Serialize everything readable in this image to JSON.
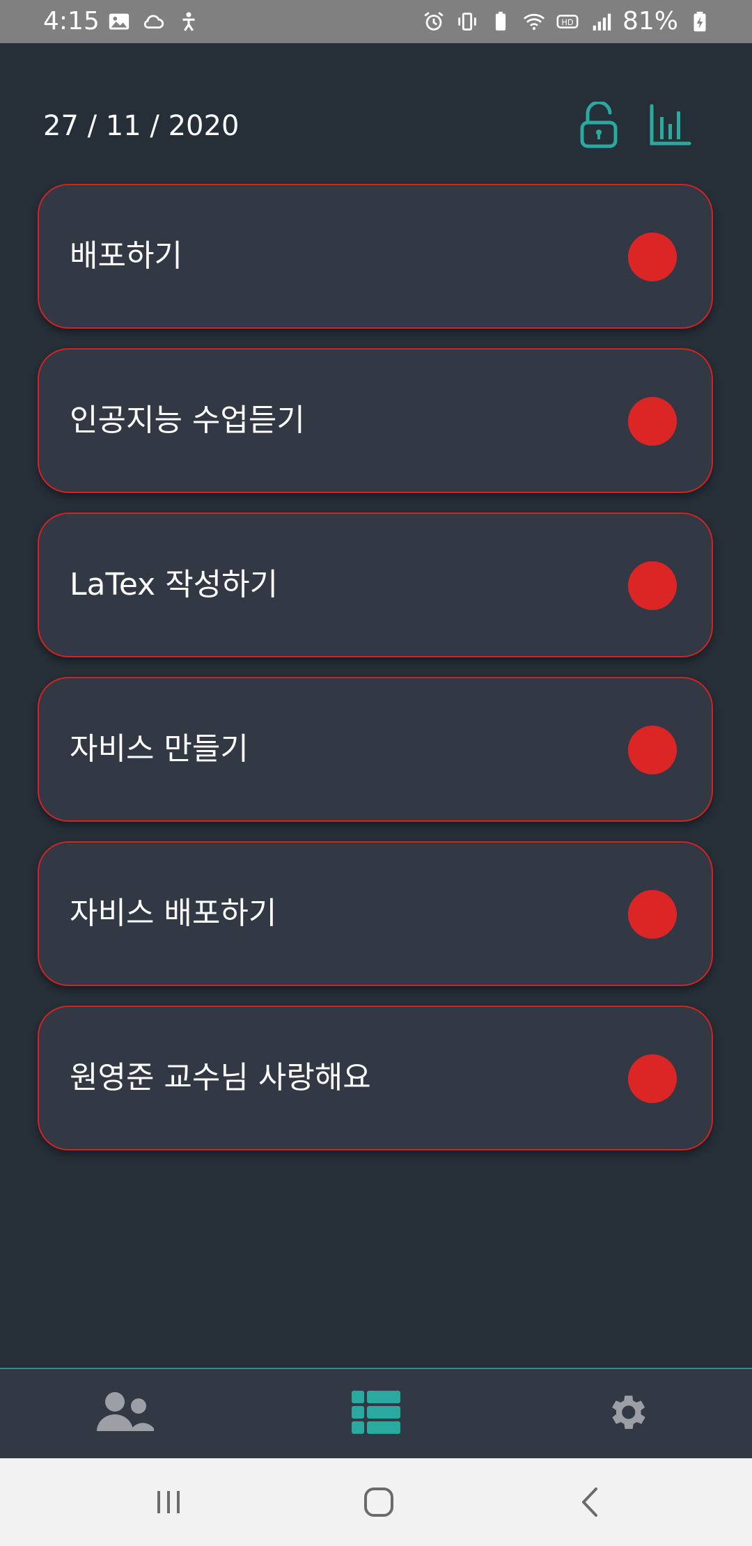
{
  "status_bar": {
    "time": "4:15",
    "battery": "81%",
    "left_icons": [
      "image-icon",
      "cloud-icon",
      "accessibility-icon"
    ],
    "right_icons": [
      "alarm-icon",
      "vibrate-icon",
      "battery-saver-icon",
      "wifi-icon",
      "hd-voice-icon",
      "signal-icon",
      "battery-charging-icon"
    ]
  },
  "header": {
    "date": "27 / 11 / 2020",
    "lock_icon": "unlock-icon",
    "stats_icon": "bar-chart-icon"
  },
  "tasks": [
    {
      "label": "배포하기",
      "status_color": "#dc2626"
    },
    {
      "label": "인공지능 수업듣기",
      "status_color": "#dc2626"
    },
    {
      "label": "LaTex 작성하기",
      "status_color": "#dc2626"
    },
    {
      "label": "자비스 만들기",
      "status_color": "#dc2626"
    },
    {
      "label": "자비스 배포하기",
      "status_color": "#dc2626"
    },
    {
      "label": "원영준 교수님 사랑해요",
      "status_color": "#dc2626"
    }
  ],
  "bottom_nav": {
    "items": [
      {
        "icon": "users-icon",
        "active": false
      },
      {
        "icon": "list-icon",
        "active": true
      },
      {
        "icon": "gear-icon",
        "active": false
      }
    ]
  },
  "system_nav": {
    "buttons": [
      "recents-icon",
      "home-icon",
      "back-icon"
    ]
  },
  "colors": {
    "background": "#262e38",
    "card": "#333944",
    "card_border": "#d32222",
    "accent": "#2aa9a0",
    "inactive_icon": "#9ca0a6"
  }
}
